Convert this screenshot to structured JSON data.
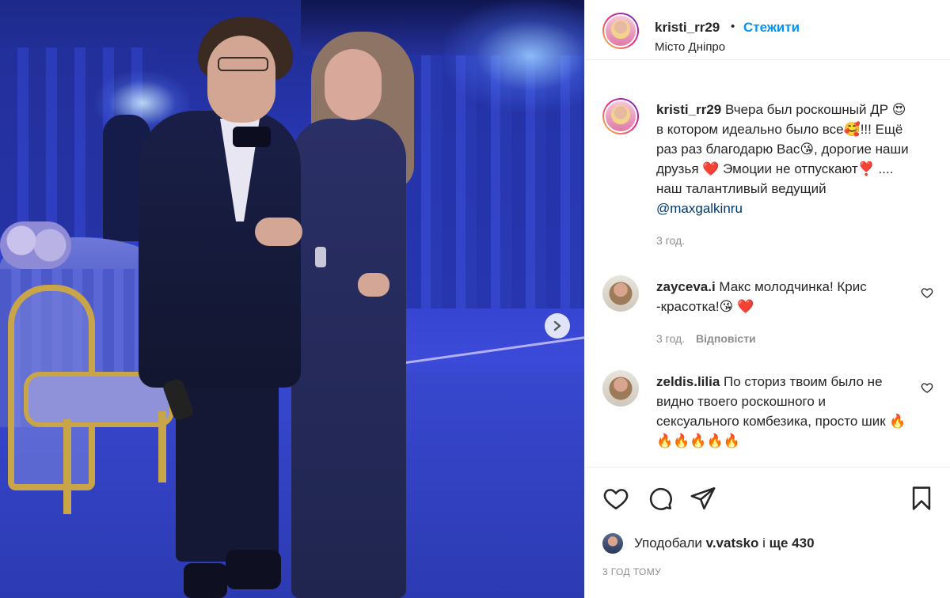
{
  "post": {
    "author": "kristi_rr29",
    "follow_label": "Стежити",
    "separator": "•",
    "location": "Місто Дніпро",
    "caption": {
      "username": "kristi_rr29",
      "body": " Вчера был роскошный ДР 😍 в котором идеально было все🥰!!! Ещё раз раз благодарю Вас😘, дорогие наши друзья ❤️ Эмоции не отпускают❣️ .... наш талантливый ведущий ",
      "mention": "@maxgalkinru",
      "time": "3 год."
    }
  },
  "comments": [
    {
      "username": "zayceva.i",
      "text": " Макс молодчинка! Крис -красотка!😘 ❤️",
      "time": "3 год.",
      "reply_label": "Відповісти"
    },
    {
      "username": "zeldis.lilia",
      "text": " По сториз твоим было не видно твоего роскошного и сексуального комбезика, просто шик 🔥🔥🔥🔥🔥🔥"
    }
  ],
  "likes": {
    "prefix": "Уподобали ",
    "user": "v.vatsko",
    "middle": " і ",
    "count": "ще 430"
  },
  "posted_time": "3 ГОД ТОМУ",
  "icons": {
    "next": "chevron-right-icon",
    "like": "heart-icon",
    "comment": "comment-bubble-icon",
    "share": "paper-plane-icon",
    "save": "bookmark-icon"
  },
  "colors": {
    "follow_blue": "#0095f6",
    "mention_blue": "#00376b",
    "muted": "#8e8e8e"
  }
}
